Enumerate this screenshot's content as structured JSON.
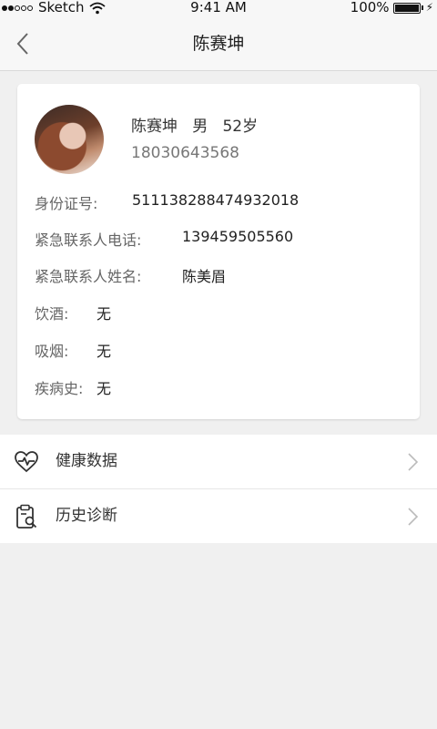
{
  "status_bar": {
    "carrier": "Sketch",
    "time": "9:41 AM",
    "battery": "100%",
    "battery_level": 1.0
  },
  "nav": {
    "title": "陈赛坤"
  },
  "profile": {
    "name": "陈赛坤",
    "gender": "男",
    "age": "52岁",
    "phone": "18030643568",
    "fields": [
      {
        "label": "身份证号:",
        "value": "511138288474932018"
      },
      {
        "label": "紧急联系人电话:",
        "value": "139459505560"
      },
      {
        "label": "紧急联系人姓名:",
        "value": "陈美眉"
      },
      {
        "label": "饮酒:",
        "value": "无"
      },
      {
        "label": "吸烟:",
        "value": "无"
      },
      {
        "label": "疾病史:",
        "value": "无"
      }
    ]
  },
  "menu": [
    {
      "label": "健康数据",
      "icon": "heart-pulse-icon"
    },
    {
      "label": "历史诊断",
      "icon": "clipboard-search-icon"
    }
  ]
}
